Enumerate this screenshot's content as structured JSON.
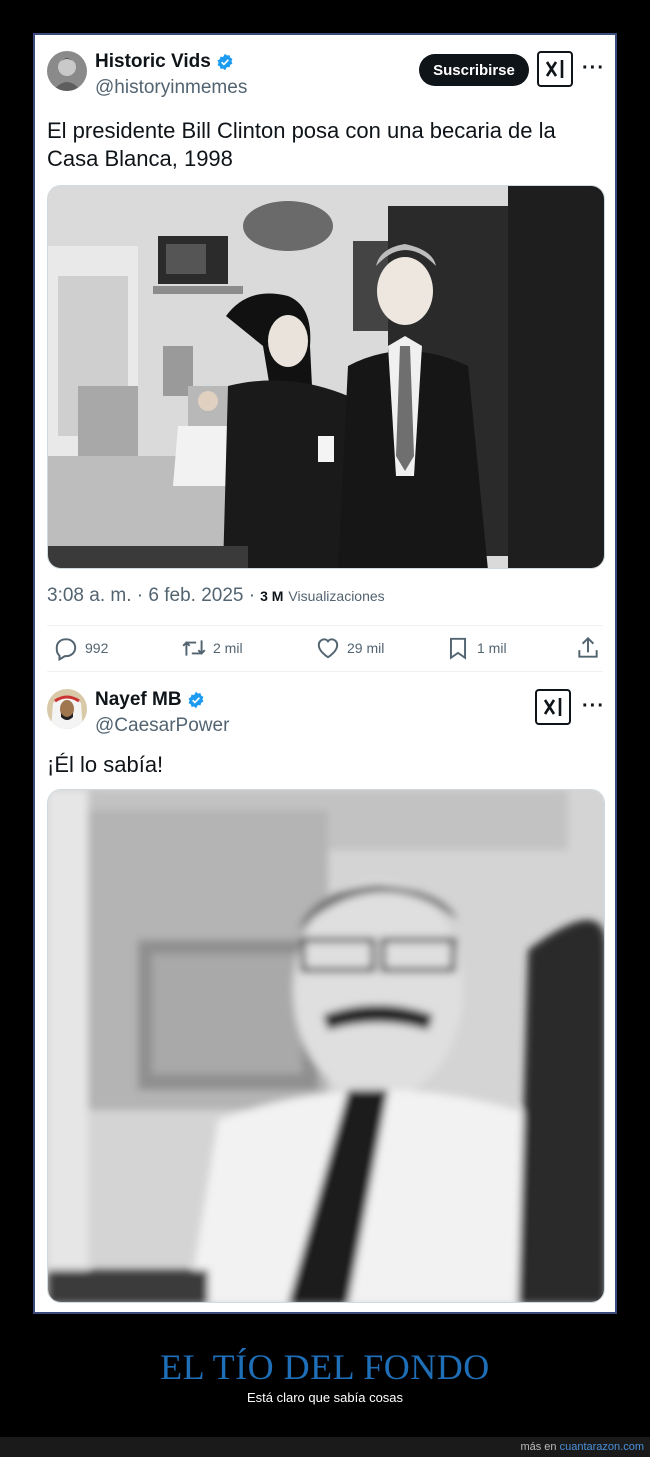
{
  "tweet1": {
    "name": "Historic Vids",
    "handle": "@historyinmemes",
    "subscribe_label": "Suscribirse",
    "more_label": "···",
    "text": "El presidente Bill Clinton posa con una becaria de la Casa Blanca, 1998",
    "timestamp": "3:08 a. m. · 6 feb. 2025 ·",
    "views_count": "3 M",
    "views_label": "Visualizaciones",
    "actions": {
      "replies": "992",
      "retweets": "2 mil",
      "likes": "29 mil",
      "bookmarks": "1 mil"
    }
  },
  "tweet2": {
    "name": "Nayef MB",
    "handle": "@CaesarPower",
    "more_label": "···",
    "text": "¡Él lo sabía!"
  },
  "caption": {
    "title": "EL TÍO DEL FONDO",
    "subtitle": "Está claro que sabía cosas"
  },
  "footer": {
    "prefix": "más en",
    "link": "cuantarazon.com"
  },
  "colors": {
    "verified": "#1d9bf0",
    "caption_title": "#1e6fb8",
    "frame_border": "#3a4a7a"
  }
}
